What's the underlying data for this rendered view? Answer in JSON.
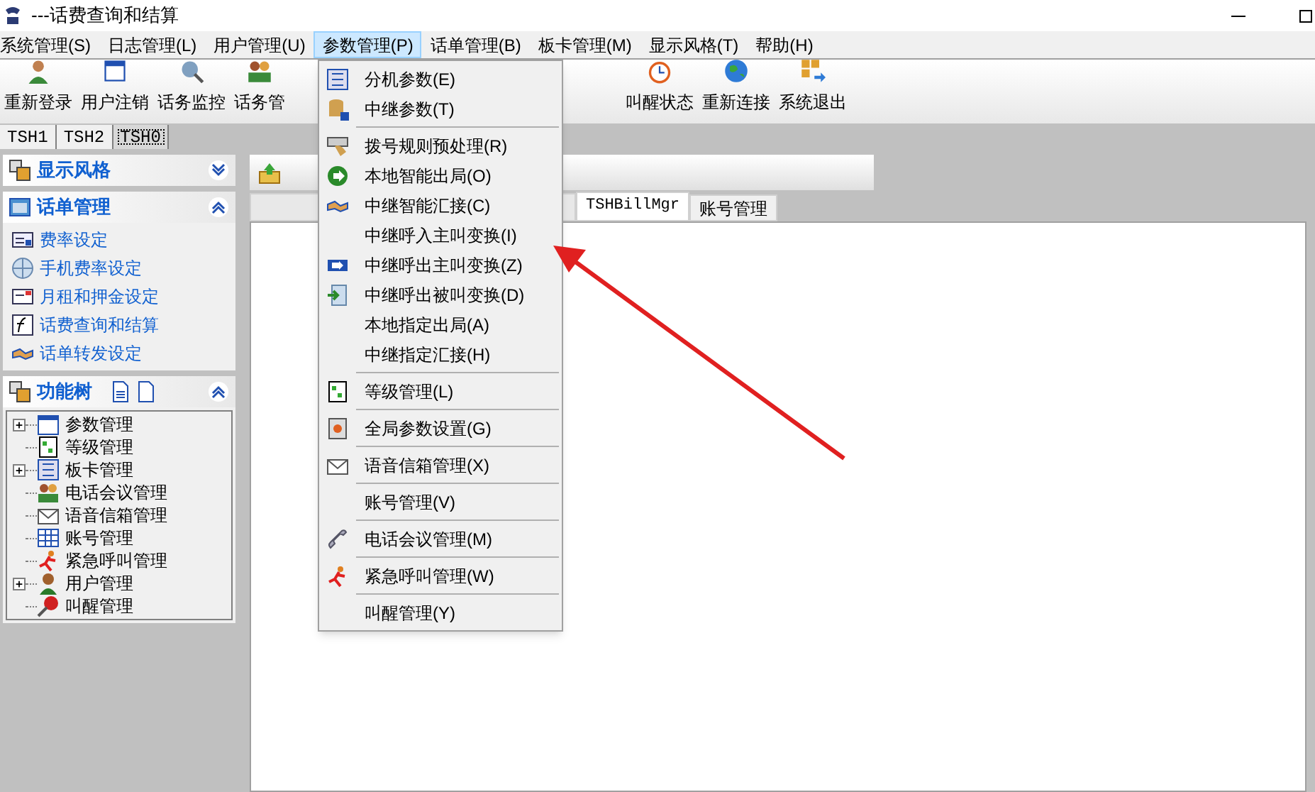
{
  "window": {
    "title": "---话费查询和结算"
  },
  "menu_bar": [
    {
      "label": "系统管理(S)",
      "selected": false
    },
    {
      "label": "日志管理(L)",
      "selected": false
    },
    {
      "label": "用户管理(U)",
      "selected": false
    },
    {
      "label": "参数管理(P)",
      "selected": true
    },
    {
      "label": "话单管理(B)",
      "selected": false
    },
    {
      "label": "板卡管理(M)",
      "selected": false
    },
    {
      "label": "显示风格(T)",
      "selected": false
    },
    {
      "label": "帮助(H)",
      "selected": false
    }
  ],
  "toolbar": [
    "重新登录",
    "用户注销",
    "话务监控",
    "话务管",
    "叫醒状态",
    "重新连接",
    "系统退出"
  ],
  "server_tabs": [
    {
      "label": "TSH1",
      "selected": false
    },
    {
      "label": "TSH2",
      "selected": false
    },
    {
      "label": "TSH0",
      "selected": true
    }
  ],
  "sidebar": {
    "panels": [
      {
        "title": "显示风格",
        "expanded": false
      },
      {
        "title": "话单管理",
        "expanded": true,
        "items": [
          "费率设定",
          "手机费率设定",
          "月租和押金设定",
          "话费查询和结算",
          "话单转发设定"
        ]
      },
      {
        "title": "功能树",
        "expanded": true,
        "tree": [
          {
            "label": "参数管理",
            "expanded": false
          },
          {
            "label": "等级管理"
          },
          {
            "label": "板卡管理",
            "expanded": false
          },
          {
            "label": "电话会议管理"
          },
          {
            "label": "语音信箱管理"
          },
          {
            "label": "账号管理"
          },
          {
            "label": "紧急呼叫管理"
          },
          {
            "label": "用户管理",
            "expanded": false
          },
          {
            "label": "叫醒管理"
          }
        ]
      }
    ]
  },
  "document_tabs": [
    {
      "label": "TSHBillMgr",
      "selected": true
    },
    {
      "label": "账号管理",
      "selected": false
    }
  ],
  "dropdown_menu": [
    {
      "kind": "item",
      "label": "分机参数(E)"
    },
    {
      "kind": "item",
      "label": "中继参数(T)"
    },
    {
      "kind": "separator"
    },
    {
      "kind": "item",
      "label": "拨号规则预处理(R)"
    },
    {
      "kind": "item",
      "label": "本地智能出局(O)"
    },
    {
      "kind": "item",
      "label": "中继智能汇接(C)"
    },
    {
      "kind": "item",
      "label": "中继呼入主叫变换(I)"
    },
    {
      "kind": "item",
      "label": "中继呼出主叫变换(Z)"
    },
    {
      "kind": "item",
      "label": "中继呼出被叫变换(D)"
    },
    {
      "kind": "item",
      "label": "本地指定出局(A)"
    },
    {
      "kind": "item",
      "label": "中继指定汇接(H)"
    },
    {
      "kind": "separator"
    },
    {
      "kind": "item",
      "label": "等级管理(L)"
    },
    {
      "kind": "separator"
    },
    {
      "kind": "item",
      "label": "全局参数设置(G)"
    },
    {
      "kind": "separator"
    },
    {
      "kind": "item",
      "label": "语音信箱管理(X)"
    },
    {
      "kind": "separator"
    },
    {
      "kind": "item",
      "label": "账号管理(V)"
    },
    {
      "kind": "separator"
    },
    {
      "kind": "item",
      "label": "电话会议管理(M)"
    },
    {
      "kind": "separator"
    },
    {
      "kind": "item",
      "label": "紧急呼叫管理(W)"
    },
    {
      "kind": "separator"
    },
    {
      "kind": "item",
      "label": "叫醒管理(Y)"
    }
  ]
}
